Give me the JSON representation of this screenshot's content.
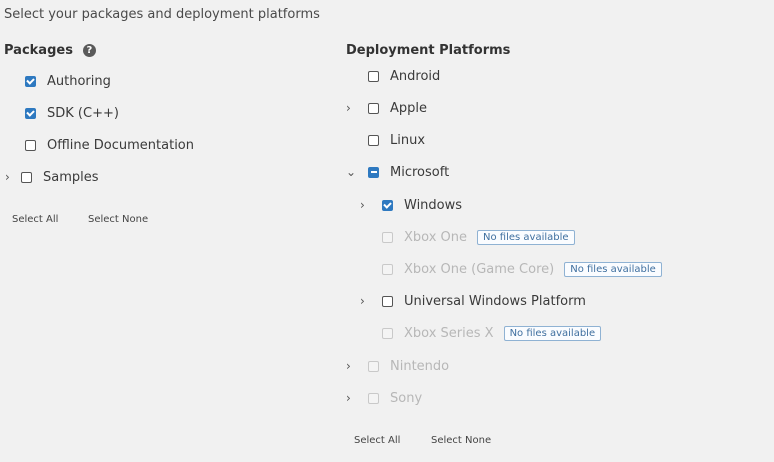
{
  "heading": "Select your packages and deployment platforms",
  "packages": {
    "title": "Packages",
    "help_icon": "?",
    "items": [
      {
        "label": "Authoring",
        "state": "checked"
      },
      {
        "label": "SDK (C++)",
        "state": "checked"
      },
      {
        "label": "Offline Documentation",
        "state": "unchecked"
      },
      {
        "label": "Samples",
        "state": "unchecked",
        "expandable": true
      }
    ],
    "select_all": "Select All",
    "select_none": "Select None"
  },
  "platforms": {
    "title": "Deployment Platforms",
    "items": [
      {
        "label": "Android",
        "state": "unchecked"
      },
      {
        "label": "Apple",
        "state": "unchecked",
        "expandable": true
      },
      {
        "label": "Linux",
        "state": "unchecked"
      },
      {
        "label": "Microsoft",
        "state": "partial",
        "expanded": true
      },
      {
        "label": "Windows",
        "state": "checked",
        "expandable": true
      },
      {
        "label": "Xbox One",
        "state": "disabled",
        "badge": "No files available"
      },
      {
        "label": "Xbox One (Game Core)",
        "state": "disabled",
        "badge": "No files available"
      },
      {
        "label": "Universal Windows Platform",
        "state": "unchecked",
        "expandable": true
      },
      {
        "label": "Xbox Series X",
        "state": "disabled",
        "badge": "No files available"
      },
      {
        "label": "Nintendo",
        "state": "disabled",
        "expandable": true
      },
      {
        "label": "Sony",
        "state": "disabled",
        "expandable": true
      }
    ],
    "select_all": "Select All",
    "select_none": "Select None"
  },
  "icons": {
    "chevron_right": "›",
    "chevron_down": "⌄"
  },
  "colors": {
    "accent": "#2e79c0",
    "background": "#f1f1f1",
    "disabled_text": "#b7b7b7"
  }
}
